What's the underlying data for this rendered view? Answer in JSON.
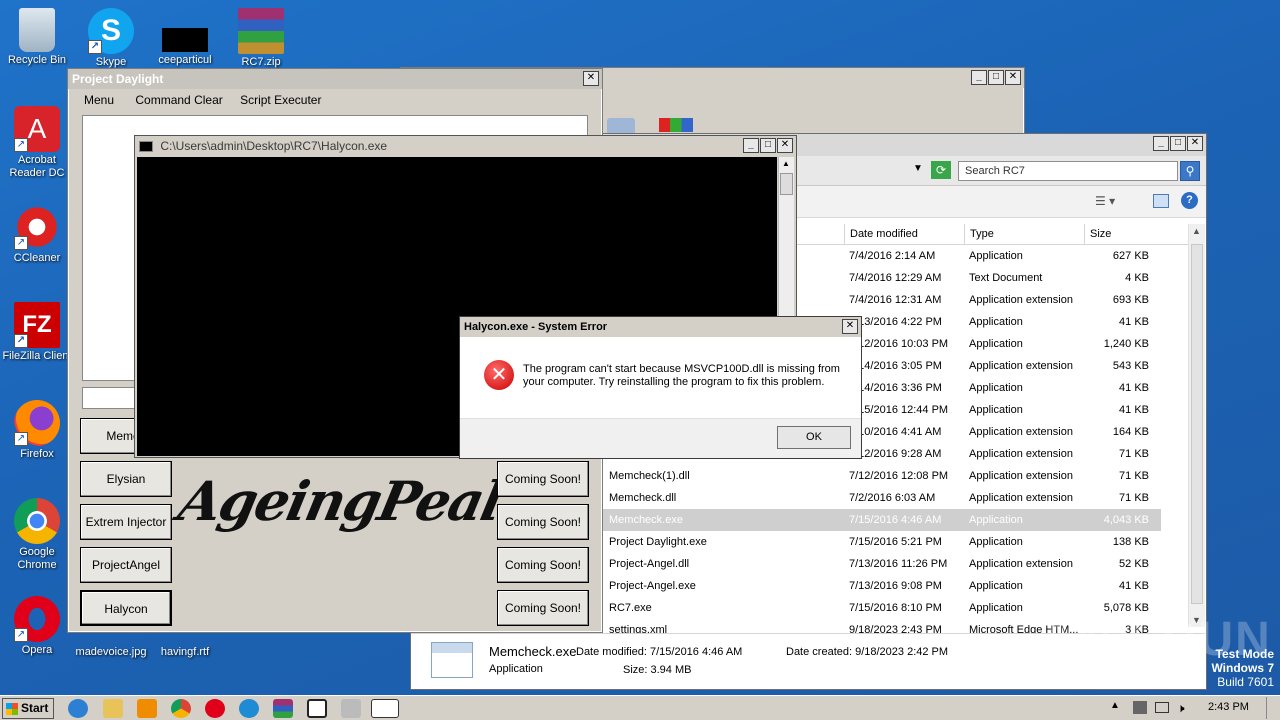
{
  "desktop": {
    "icons": [
      {
        "label": "Recycle Bin"
      },
      {
        "label": "Skype"
      },
      {
        "label": "ceeparticul"
      },
      {
        "label": "RC7.zip"
      },
      {
        "label": "Acrobat Reader DC"
      },
      {
        "label": "CCleaner"
      },
      {
        "label": "FileZilla Client"
      },
      {
        "label": "Firefox"
      },
      {
        "label": "Google Chrome"
      },
      {
        "label": "Opera"
      },
      {
        "label": "madevoice.jpg"
      },
      {
        "label": "havingf.rtf"
      }
    ]
  },
  "project_daylight": {
    "title": "Project Daylight",
    "menu": [
      "Menu",
      "Command Clear",
      "Script Executer"
    ],
    "logo_text": "AgeingPeal",
    "left_buttons": [
      "Memch",
      "Elysian",
      "Extrem Injector",
      "ProjectAngel",
      "Halycon"
    ],
    "right_buttons": [
      "Coming Soon!",
      "Coming Soon!",
      "Coming Soon!",
      "Coming Soon!"
    ]
  },
  "console": {
    "title": "C:\\Users\\admin\\Desktop\\RC7\\Halycon.exe"
  },
  "error_dialog": {
    "title": "Halycon.exe - System Error",
    "message": "The program can't start because MSVCP100D.dll is missing from your computer. Try reinstalling the program to fix this problem.",
    "ok_label": "OK"
  },
  "explorer": {
    "search_placeholder": "Search RC7",
    "columns": {
      "date": "Date modified",
      "type": "Type",
      "size": "Size"
    },
    "rows": [
      {
        "name": "",
        "date": "7/4/2016 2:14 AM",
        "type": "Application",
        "size": "627 KB"
      },
      {
        "name": "",
        "date": "7/4/2016 12:29 AM",
        "type": "Text Document",
        "size": "4 KB"
      },
      {
        "name": "",
        "date": "7/4/2016 12:31 AM",
        "type": "Application extension",
        "size": "693 KB"
      },
      {
        "name": "",
        "date": "7/13/2016 4:22 PM",
        "type": "Application",
        "size": "41 KB"
      },
      {
        "name": "",
        "date": "7/12/2016 10:03 PM",
        "type": "Application",
        "size": "1,240 KB"
      },
      {
        "name": "",
        "date": "7/14/2016 3:05 PM",
        "type": "Application extension",
        "size": "543 KB"
      },
      {
        "name": "",
        "date": "7/14/2016 3:36 PM",
        "type": "Application",
        "size": "41 KB"
      },
      {
        "name": "",
        "date": "7/15/2016 12:44 PM",
        "type": "Application",
        "size": "41 KB"
      },
      {
        "name": "",
        "date": "7/10/2016 4:41 AM",
        "type": "Application extension",
        "size": "164 KB"
      },
      {
        "name": "",
        "date": "7/12/2016 9:28 AM",
        "type": "Application extension",
        "size": "71 KB"
      },
      {
        "name": "Memcheck(1).dll",
        "date": "7/12/2016 12:08 PM",
        "type": "Application extension",
        "size": "71 KB"
      },
      {
        "name": "Memcheck.dll",
        "date": "7/2/2016 6:03 AM",
        "type": "Application extension",
        "size": "71 KB"
      },
      {
        "name": "Memcheck.exe",
        "date": "7/15/2016 4:46 AM",
        "type": "Application",
        "size": "4,043 KB"
      },
      {
        "name": "Project Daylight.exe",
        "date": "7/15/2016 5:21 PM",
        "type": "Application",
        "size": "138 KB"
      },
      {
        "name": "Project-Angel.dll",
        "date": "7/13/2016 11:26 PM",
        "type": "Application extension",
        "size": "52 KB"
      },
      {
        "name": "Project-Angel.exe",
        "date": "7/13/2016 9:08 PM",
        "type": "Application",
        "size": "41 KB"
      },
      {
        "name": "RC7.exe",
        "date": "7/15/2016 8:10 PM",
        "type": "Application",
        "size": "5,078 KB"
      },
      {
        "name": "settings.xml",
        "date": "9/18/2023 2:43 PM",
        "type": "Microsoft Edge HTM...",
        "size": "3 KB"
      }
    ],
    "details": {
      "name": "Memcheck.exe",
      "type": "Application",
      "modified_label": "Date modified: 7/15/2016 4:46 AM",
      "created_label": "Date created: 9/18/2023 2:42 PM",
      "size_label": "Size: 3.94 MB"
    }
  },
  "watermark": {
    "line1": "Test Mode",
    "line2": "Windows 7",
    "line3": "Build 7601",
    "brand": "ANY RUN"
  },
  "taskbar": {
    "start_label": "Start",
    "clock": "2:43 PM"
  }
}
